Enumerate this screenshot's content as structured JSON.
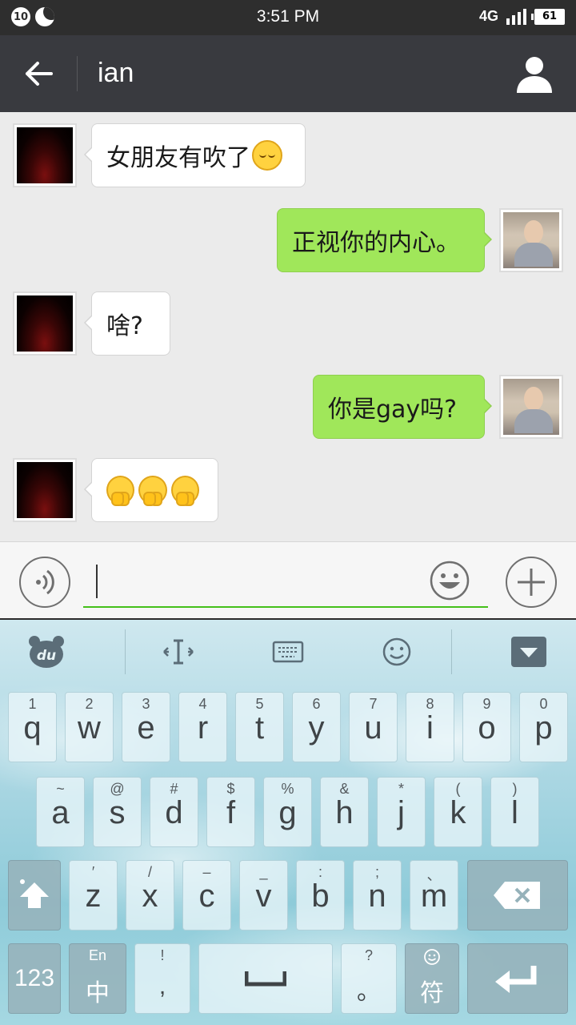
{
  "status_bar": {
    "notification_count": "10",
    "time": "3:51 PM",
    "network": "4G",
    "battery": "61"
  },
  "title_bar": {
    "title": "ian",
    "back_icon": "arrow-left-icon",
    "profile_icon": "person-icon"
  },
  "messages": [
    {
      "direction": "in",
      "text": "女朋友有吹了",
      "emoji": "pensive-face"
    },
    {
      "direction": "out",
      "text": "正视你的内心。"
    },
    {
      "direction": "in",
      "text": "啥?"
    },
    {
      "direction": "out",
      "text": "你是gay吗?"
    },
    {
      "direction": "in",
      "text": "",
      "emoji": "hugging-face x3"
    }
  ],
  "input_bar": {
    "voice_icon": "voice-icon",
    "emoji_icon": "smiley-icon",
    "plus_icon": "plus-icon",
    "value": ""
  },
  "keyboard": {
    "toolbar": {
      "logo": "du",
      "cursor_icon": "cursor-move-icon",
      "keyboard_icon": "keyboard-icon",
      "emoji_icon": "smiley-icon",
      "hide_icon": "hide-keyboard-icon"
    },
    "row1": [
      {
        "sub": "1",
        "main": "q"
      },
      {
        "sub": "2",
        "main": "w"
      },
      {
        "sub": "3",
        "main": "e"
      },
      {
        "sub": "4",
        "main": "r"
      },
      {
        "sub": "5",
        "main": "t"
      },
      {
        "sub": "6",
        "main": "y"
      },
      {
        "sub": "7",
        "main": "u"
      },
      {
        "sub": "8",
        "main": "i"
      },
      {
        "sub": "9",
        "main": "o"
      },
      {
        "sub": "0",
        "main": "p"
      }
    ],
    "row2": [
      {
        "sub": "~",
        "main": "a"
      },
      {
        "sub": "@",
        "main": "s"
      },
      {
        "sub": "#",
        "main": "d"
      },
      {
        "sub": "$",
        "main": "f"
      },
      {
        "sub": "%",
        "main": "g"
      },
      {
        "sub": "&",
        "main": "h"
      },
      {
        "sub": "*",
        "main": "j"
      },
      {
        "sub": "(",
        "main": "k"
      },
      {
        "sub": ")",
        "main": "l"
      }
    ],
    "row3": [
      {
        "sub": "′",
        "main": "z"
      },
      {
        "sub": "/",
        "main": "x"
      },
      {
        "sub": "–",
        "main": "c"
      },
      {
        "sub": "_",
        "main": "v"
      },
      {
        "sub": ":",
        "main": "b"
      },
      {
        "sub": ";",
        "main": "n"
      },
      {
        "sub": "、",
        "main": "m"
      }
    ],
    "row4": {
      "num": "123",
      "lang_sub": "En",
      "lang_main": "中",
      "comma_sub": "!",
      "comma_main": ",",
      "period_sub": "?",
      "period_main": "。",
      "symbol_main": "符"
    }
  }
}
